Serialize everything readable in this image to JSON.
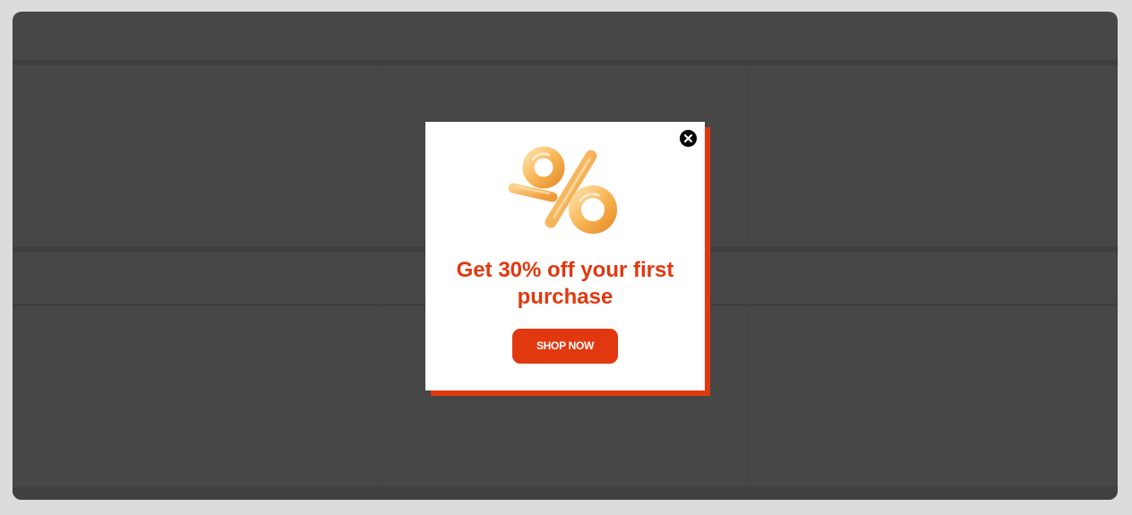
{
  "popup": {
    "headline": "Get 30% off your first purchase",
    "cta_label": "SHOP NOW",
    "close_icon": "close-icon",
    "graphic_icon": "percent-balloon-icon"
  },
  "colors": {
    "accent": "#e2380f",
    "overlay": "#474747",
    "popup_background": "#ffffff",
    "balloon": "#f7b556"
  }
}
